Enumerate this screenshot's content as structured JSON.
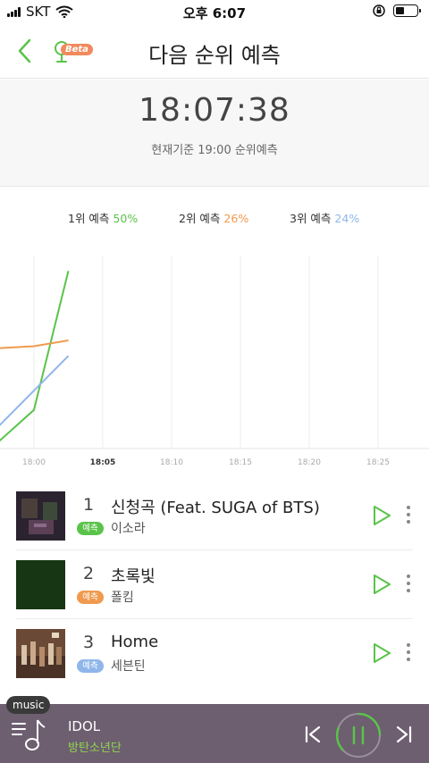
{
  "status_bar": {
    "carrier": "SKT",
    "time": "오후 6:07"
  },
  "header": {
    "title": "다음 순위 예측",
    "beta_label": "Beta"
  },
  "clock": {
    "time": "18:07:38",
    "subtitle": "현재기준 19:00 순위예측"
  },
  "legend": [
    {
      "label": "1위 예측",
      "percent": "50%",
      "color": "#5ac34a"
    },
    {
      "label": "2위 예측",
      "percent": "26%",
      "color": "#ef9a4f"
    },
    {
      "label": "3위 예측",
      "percent": "24%",
      "color": "#8fb6ea"
    }
  ],
  "chart_data": {
    "type": "line",
    "x": [
      "18:00",
      "18:05",
      "18:10",
      "18:15",
      "18:20",
      "18:25"
    ],
    "current_tick": "18:05",
    "grid": "vertical",
    "series": [
      {
        "name": "1위 예측",
        "color": "#5ac34a",
        "points": [
          [
            17.5,
            4
          ],
          [
            18.0,
            20
          ],
          [
            18.5,
            92
          ]
        ]
      },
      {
        "name": "2위 예측",
        "color": "#ef9a4f",
        "points": [
          [
            17.5,
            52
          ],
          [
            18.0,
            53
          ],
          [
            18.5,
            56
          ]
        ]
      },
      {
        "name": "3위 예측",
        "color": "#8fb6ea",
        "points": [
          [
            17.5,
            12
          ],
          [
            18.0,
            30
          ],
          [
            18.5,
            48
          ]
        ]
      }
    ]
  },
  "ranks": [
    {
      "rank": "1",
      "title": "신청곡 (Feat. SUGA of BTS)",
      "artist": "이소라",
      "badge": "예측",
      "badge_color": "#5ac34a"
    },
    {
      "rank": "2",
      "title": "초록빛",
      "artist": "폴킴",
      "badge": "예측",
      "badge_color": "#ef9a4f"
    },
    {
      "rank": "3",
      "title": "Home",
      "artist": "세븐틴",
      "badge": "예측",
      "badge_color": "#8fb6ea"
    }
  ],
  "player": {
    "tag": "music",
    "title": "IDOL",
    "artist": "방탄소년단"
  },
  "colors": {
    "accent": "#5ac34a",
    "player_bg": "#6d5e70"
  }
}
